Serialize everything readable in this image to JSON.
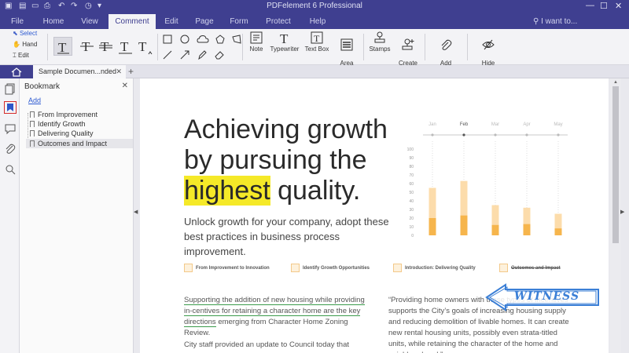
{
  "window": {
    "title": "PDFelement 6 Professional"
  },
  "menubar": {
    "items": [
      "File",
      "Home",
      "View",
      "Comment",
      "Edit",
      "Page",
      "Form",
      "Protect",
      "Help"
    ],
    "active": "Comment",
    "search_label": "I want to..."
  },
  "ribbon": {
    "select_label": "Select",
    "hand_label": "Hand",
    "edit_label": "Edit",
    "note_label": "Note",
    "typewriter_label": "Typewriter",
    "textbox_label": "Text Box",
    "area_highlight_label": "Area\nHighlight",
    "stamps_label": "Stamps",
    "create_stamp_label": "Create\nStamp",
    "add_attachment_label": "Add\nAttachment",
    "hide_annotations_label": "Hide\nAnnotations"
  },
  "tabs": {
    "doc_tab_label": "Sample Documen...nded"
  },
  "bookmark_panel": {
    "title": "Bookmark",
    "add_label": "Add",
    "items": [
      {
        "label": "From Improvement"
      },
      {
        "label": "Identify Growth"
      },
      {
        "label": "Delivering Quality"
      },
      {
        "label": "Outcomes and Impact"
      }
    ]
  },
  "document": {
    "headline_line1": "Achieving growth",
    "headline_line2": "by pursuing the",
    "headline_highlight": "highest",
    "headline_line3_rest": " quality.",
    "subhead": "Unlock growth for your company, adopt these best practices in business process improvement.",
    "topics": [
      "From Improvement to Innovation",
      "Identify Growth Opportunities",
      "Introduction: Delivering Quality",
      "Outcomes and Impact"
    ],
    "left_para_underlined": "Supporting the addition of new housing while providing in-centives for retaining a character home are the key directions",
    "left_para_rest": "emerging from Character Home Zoning Review.",
    "left_para2": "City staff provided an update to Council today that summa-",
    "right_para": "“Providing home owners with these types of incentives supports the City’s goals of increasing housing supply and reducing demolition of livable homes.  It can create new rental housing units, possibly even strata-titled units, while retaining the character of the home and neighbourhood,”",
    "stamp_text": "WITNESS"
  },
  "colors": {
    "brand": "#3f3f90",
    "highlight": "#f5e928",
    "underline": "#3a9a4a",
    "strike": "#d63b3b",
    "stamp": "#3b7fd6",
    "bar_light": "#fcdcab",
    "bar_dark": "#f6b54c"
  },
  "chart_data": {
    "type": "bar",
    "categories": [
      "Jan",
      "Feb",
      "Mar",
      "Apr",
      "May"
    ],
    "series": [
      {
        "values": [
          55,
          63,
          35,
          32,
          25
        ]
      },
      {
        "values": [
          20,
          23,
          12,
          13,
          8
        ]
      }
    ],
    "stacked": false,
    "ylim": [
      0,
      100
    ],
    "yticks": [
      0,
      10,
      20,
      30,
      40,
      50,
      60,
      70,
      80,
      90,
      100
    ],
    "highlighted_category": "Feb",
    "grid": false
  }
}
